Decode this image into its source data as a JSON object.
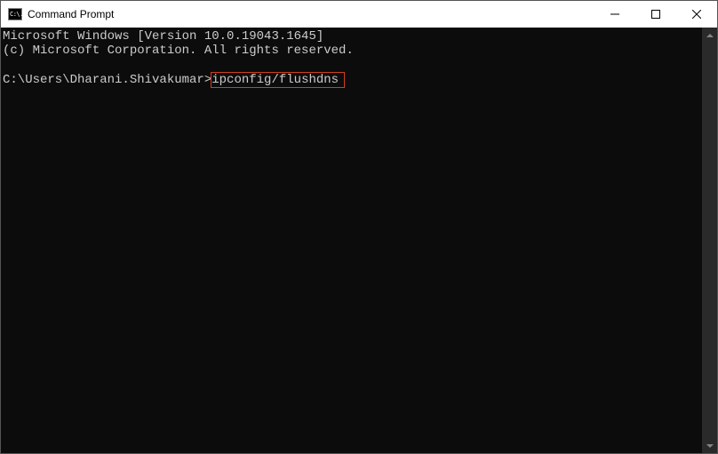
{
  "window": {
    "title": "Command Prompt"
  },
  "terminal": {
    "line1": "Microsoft Windows [Version 10.0.19043.1645]",
    "line2": "(c) Microsoft Corporation. All rights reserved.",
    "prompt": "C:\\Users\\Dharani.Shivakumar>",
    "command": "ipconfig/flushdns"
  },
  "icons": {
    "cmd_glyph": "C:\\."
  }
}
